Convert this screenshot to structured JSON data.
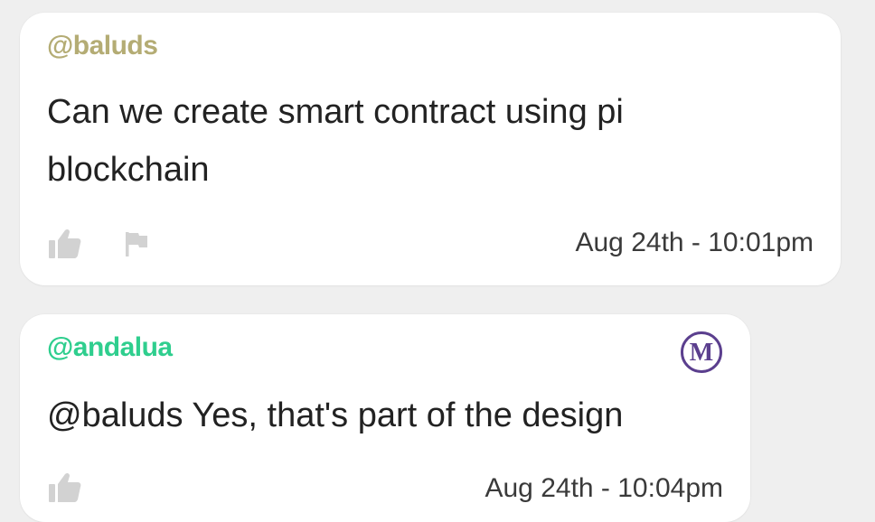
{
  "comments": [
    {
      "username": "@baluds",
      "username_color": "#b4ac74",
      "text": "Can we create smart contract using pi blockchain",
      "timestamp": "Aug 24th - 10:01pm",
      "icons": [
        "thumbs-up-icon",
        "flag-icon"
      ]
    },
    {
      "username": "@andalua",
      "username_color": "#2fce8e",
      "text": "@baluds Yes, that's part of the design",
      "timestamp": "Aug 24th - 10:04pm",
      "badge": "M",
      "badge_color": "#5b3f8e",
      "icons": [
        "thumbs-up-icon",
        "moderator-badge-icon"
      ]
    }
  ]
}
